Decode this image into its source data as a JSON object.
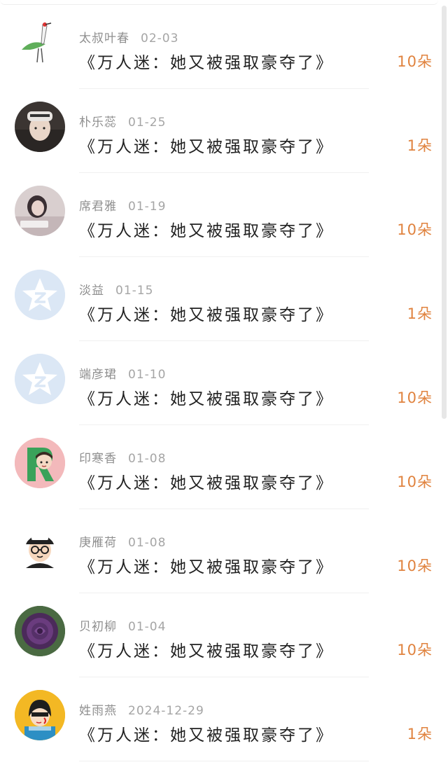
{
  "rows": [
    {
      "name": "太叔叶春",
      "date": "02-03",
      "title": "《万人迷：她又被强取豪夺了》",
      "count": "10朵",
      "avatar": "crane-avatar-icon"
    },
    {
      "name": "朴乐蕊",
      "date": "01-25",
      "title": "《万人迷：她又被强取豪夺了》",
      "count": "1朵",
      "avatar": "person-beanie-avatar-icon"
    },
    {
      "name": "席君雅",
      "date": "01-19",
      "title": "《万人迷：她又被强取豪夺了》",
      "count": "10朵",
      "avatar": "girl-photo-avatar-icon"
    },
    {
      "name": "淡益",
      "date": "01-15",
      "title": "《万人迷：她又被强取豪夺了》",
      "count": "1朵",
      "avatar": "default-star-avatar-icon"
    },
    {
      "name": "端彦珺",
      "date": "01-10",
      "title": "《万人迷：她又被强取豪夺了》",
      "count": "10朵",
      "avatar": "default-star-avatar-icon"
    },
    {
      "name": "印寒香",
      "date": "01-08",
      "title": "《万人迷：她又被强取豪夺了》",
      "count": "10朵",
      "avatar": "letter-r-cartoon-avatar-icon"
    },
    {
      "name": "庚雁荷",
      "date": "01-08",
      "title": "《万人迷：她又被强取豪夺了》",
      "count": "10朵",
      "avatar": "cartoon-cap-avatar-icon"
    },
    {
      "name": "贝初柳",
      "date": "01-04",
      "title": "《万人迷：她又被强取豪夺了》",
      "count": "10朵",
      "avatar": "purple-rose-avatar-icon"
    },
    {
      "name": "姓雨燕",
      "date": "2024-12-29",
      "title": "《万人迷：她又被强取豪夺了》",
      "count": "1朵",
      "avatar": "cartoon-girl-yellow-avatar-icon"
    }
  ],
  "colors": {
    "count": "#e0833f",
    "name": "#8f8f8f",
    "title": "#222222",
    "default_avatar_bg": "#dbe7f5"
  }
}
